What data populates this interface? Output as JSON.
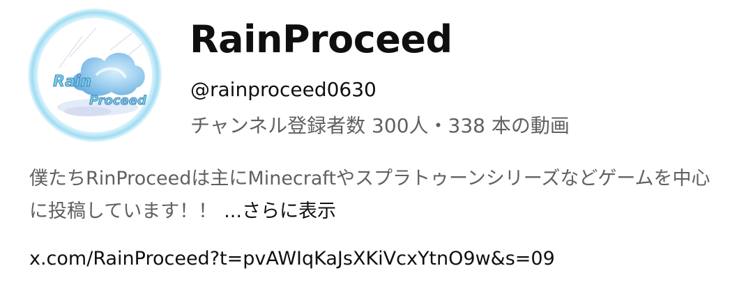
{
  "channel": {
    "avatar_text_line1": "Rain",
    "avatar_text_line2": "Proceed",
    "name": "RainProceed",
    "handle": "@rainproceed0630",
    "stats": "チャンネル登録者数 300人・338 本の動画"
  },
  "description": {
    "text": "僕たちRinProceedは主にMinecraftやスプラトゥーンシリーズなどゲームを中心に投稿しています！！",
    "more_label": "...さらに表示"
  },
  "link": {
    "text": "x.com/RainProceed?t=pvAWIqKaJsXKiVcxYtnO9w&s=09"
  },
  "colors": {
    "primary_text": "#0f0f0f",
    "secondary_text": "#606060",
    "avatar_ring": "#bfe6f4",
    "avatar_cloud": "#8cc8ea",
    "avatar_text": "#6fd0e6"
  }
}
